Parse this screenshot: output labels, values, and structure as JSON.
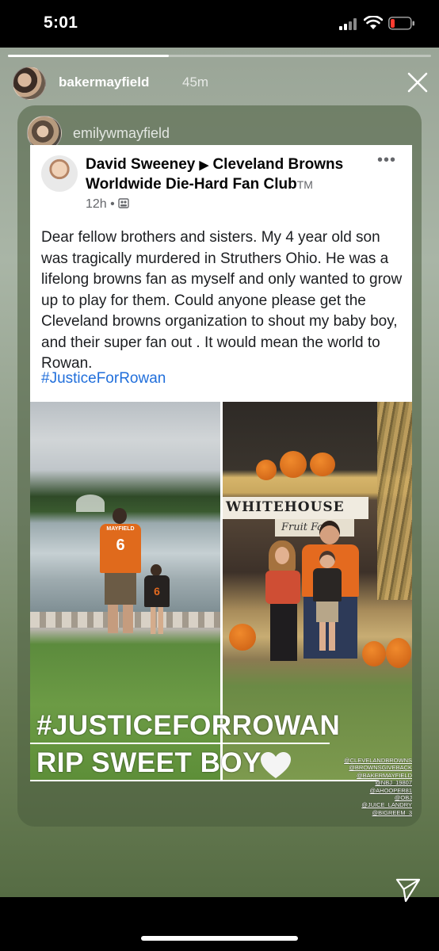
{
  "status_bar": {
    "time": "5:01"
  },
  "story": {
    "progress": 0.38,
    "username": "bakermayfield",
    "time_ago": "45m",
    "reshared_from": "emilywmayfield",
    "close_icon": "close-icon",
    "send_icon": "send-icon"
  },
  "post": {
    "author": "David Sweeney",
    "arrow": "▶",
    "group": "Cleveland Browns Worldwide Die-Hard Fan Club",
    "group_tm": "TM",
    "time": "12h",
    "dot": "•",
    "more": "•••",
    "body": "Dear fellow brothers and sisters. My 4 year old son was tragically murdered in Struthers Ohio. He was a lifelong browns fan as myself and only wanted to grow up to play for them. Could anyone please get the Cleveland browns organization to shout my baby boy, and their super fan out . It would mean the world to Rowan.",
    "hashtag": "#JusticeForRowan"
  },
  "photos": {
    "left_jersey_name": "MAYFIELD",
    "left_jersey_number": "6",
    "left_kid_number": "6",
    "sign_text": "WHITEHOUSE",
    "sign_sub": "Fruit Fa"
  },
  "overlay": {
    "title": "#JUSTICEFORROWAN",
    "subtitle": "RIP SWEET BOY",
    "heart_icon": "white-heart-icon",
    "mentions": [
      "@CLEVELANDBROWNS",
      "@BROWNSGIVEBACK",
      "@BAKERMAYFIELD",
      "@NBJ_19807",
      "@AHOOPER81",
      "@OBJ",
      "@JUICE_LANDRY",
      "@BIGREEM_3"
    ]
  },
  "colors": {
    "link": "#216fdb",
    "browns_orange": "#e46a1f"
  }
}
